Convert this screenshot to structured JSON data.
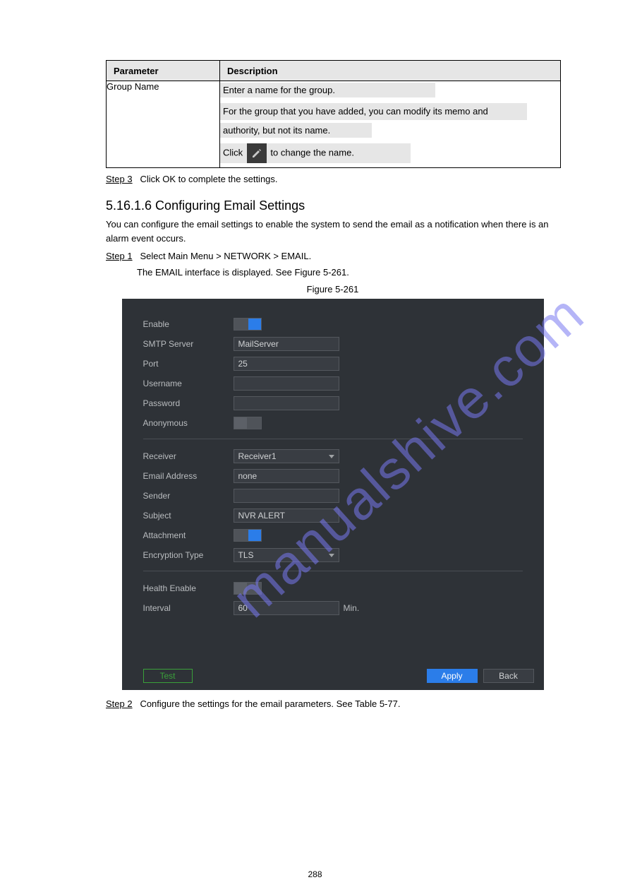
{
  "table": {
    "col1_header": "Parameter",
    "col2_header": "Description",
    "row_param": "Group Name",
    "desc_line1": "Enter a name for the group.",
    "note_label": "",
    "desc_line2a": "For the group that you have added, you can modify its memo and",
    "desc_line2b": "authority, but not its name.",
    "desc_click": "Click ",
    "desc_click_after": " to change the name."
  },
  "steps": {
    "step3_label": "Step 3",
    "step3_text": "Click OK to complete the settings."
  },
  "email_section": {
    "heading": "5.16.1.6 Configuring Email Settings",
    "intro": "You can configure the email settings to enable the system to send the email as a notification when there is an alarm event occurs.",
    "step1_label": "Step 1",
    "step1_text": "Select Main Menu > NETWORK > EMAIL.",
    "step1_result": "The EMAIL interface is displayed. See Figure 5-261.",
    "figure_caption": "Figure 5-261",
    "step2_label": "Step 2",
    "step2_text": "Configure the settings for the email parameters. See Table 5-77."
  },
  "form": {
    "enable_label": "Enable",
    "smtp_label": "SMTP Server",
    "smtp_value": "MailServer",
    "port_label": "Port",
    "port_value": "25",
    "username_label": "Username",
    "username_value": "",
    "password_label": "Password",
    "password_value": "",
    "anonymous_label": "Anonymous",
    "receiver_label": "Receiver",
    "receiver_value": "Receiver1",
    "email_addr_label": "Email Address",
    "email_addr_value": "none",
    "sender_label": "Sender",
    "sender_value": "",
    "subject_label": "Subject",
    "subject_value": "NVR ALERT",
    "attachment_label": "Attachment",
    "encryption_label": "Encryption Type",
    "encryption_value": "TLS",
    "health_label": "Health Enable",
    "interval_label": "Interval",
    "interval_value": "60",
    "interval_unit": "Min.",
    "test_btn": "Test",
    "apply_btn": "Apply",
    "back_btn": "Back"
  },
  "page_number": "288",
  "watermark": "manualshive.com"
}
